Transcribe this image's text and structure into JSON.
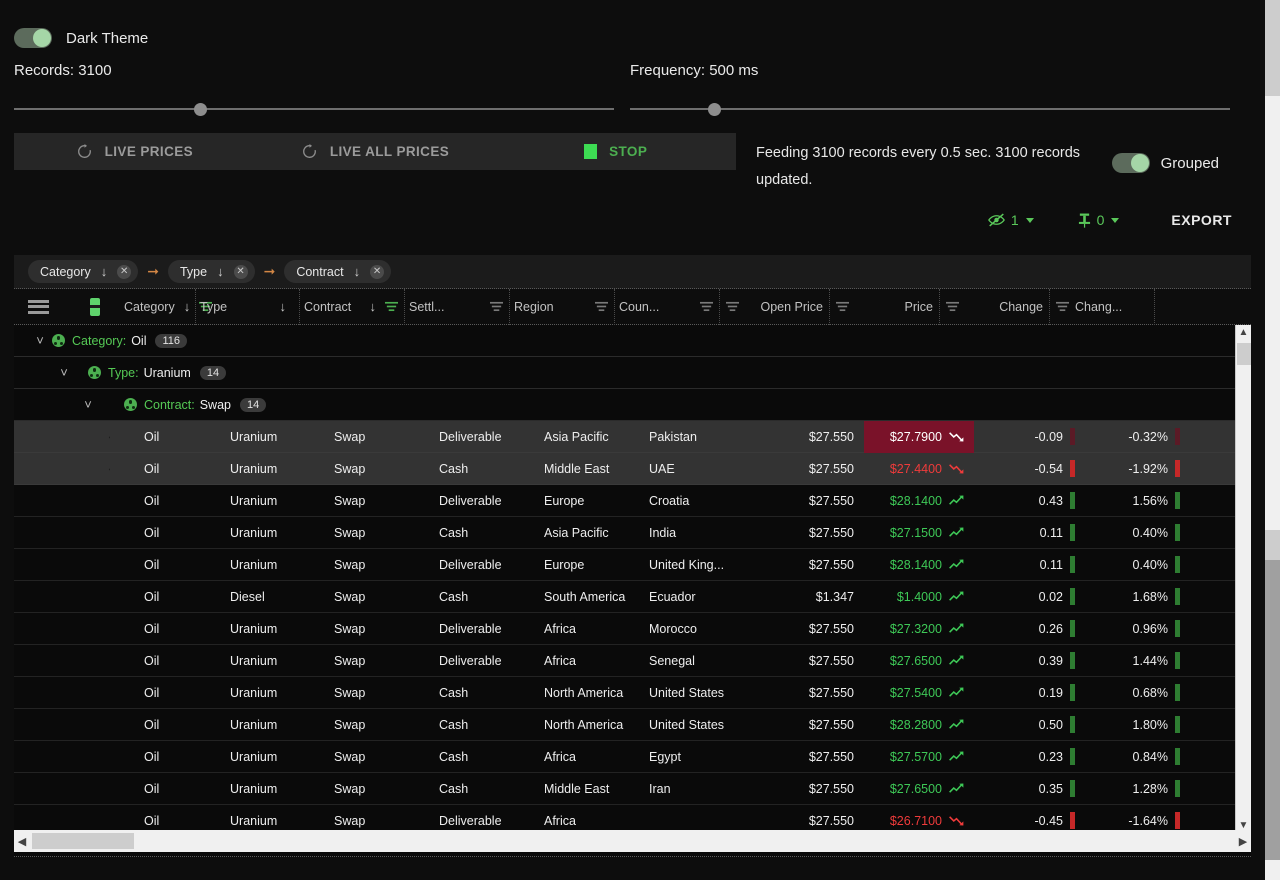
{
  "theme": {
    "toggle_on": true,
    "label": "Dark Theme"
  },
  "controls": {
    "records_label": "Records: 3100",
    "frequency_label": "Frequency: 500 ms"
  },
  "actions": {
    "live_prices": "LIVE PRICES",
    "live_all_prices": "LIVE ALL PRICES",
    "stop": "STOP"
  },
  "status": {
    "text": "Feeding 3100 records every 0.5 sec. 3100 records updated.",
    "grouped_label": "Grouped",
    "grouped_on": true
  },
  "grid_tools": {
    "hidden_count": "1",
    "pinned_count": "0",
    "export_label": "EXPORT"
  },
  "rowgroup_chips": [
    {
      "label": "Category"
    },
    {
      "label": "Type"
    },
    {
      "label": "Contract"
    }
  ],
  "columns": [
    {
      "key": "category",
      "label": "Category",
      "sort": "desc",
      "filter": true
    },
    {
      "key": "type",
      "label": "Type",
      "sort": "desc",
      "filter": false
    },
    {
      "key": "contract",
      "label": "Contract",
      "sort": "desc",
      "filter": true
    },
    {
      "key": "settl",
      "label": "Settl...",
      "filter": true
    },
    {
      "key": "region",
      "label": "Region",
      "filter": true
    },
    {
      "key": "country",
      "label": "Coun...",
      "filter": true
    },
    {
      "key": "open_price",
      "label": "Open Price",
      "filter": true
    },
    {
      "key": "price",
      "label": "Price",
      "filter": true
    },
    {
      "key": "change",
      "label": "Change",
      "filter": true
    },
    {
      "key": "change_pct",
      "label": "Chang...",
      "filter": true
    }
  ],
  "groups": [
    {
      "key": "Category",
      "value": "Oil",
      "count": "116",
      "level": 0
    },
    {
      "key": "Type",
      "value": "Uranium",
      "count": "14",
      "level": 1
    },
    {
      "key": "Contract",
      "value": "Swap",
      "count": "14",
      "level": 2
    }
  ],
  "rows": [
    {
      "selected": true,
      "category": "Oil",
      "type": "Uranium",
      "contract": "Swap",
      "settl": "Deliverable",
      "region": "Asia Pacific",
      "country": "Pakistan",
      "open_price": "$27.550",
      "price": "$27.7900",
      "dir": "down",
      "flash": true,
      "change": "-0.09",
      "change_pct": "-0.32%"
    },
    {
      "selected": true,
      "category": "Oil",
      "type": "Uranium",
      "contract": "Swap",
      "settl": "Cash",
      "region": "Middle East",
      "country": "UAE",
      "open_price": "$27.550",
      "price": "$27.4400",
      "dir": "down",
      "flash": false,
      "change": "-0.54",
      "change_pct": "-1.92%"
    },
    {
      "selected": false,
      "category": "Oil",
      "type": "Uranium",
      "contract": "Swap",
      "settl": "Deliverable",
      "region": "Europe",
      "country": "Croatia",
      "open_price": "$27.550",
      "price": "$28.1400",
      "dir": "up",
      "flash": false,
      "change": "0.43",
      "change_pct": "1.56%"
    },
    {
      "selected": false,
      "category": "Oil",
      "type": "Uranium",
      "contract": "Swap",
      "settl": "Cash",
      "region": "Asia Pacific",
      "country": "India",
      "open_price": "$27.550",
      "price": "$27.1500",
      "dir": "up",
      "flash": false,
      "change": "0.11",
      "change_pct": "0.40%"
    },
    {
      "selected": false,
      "category": "Oil",
      "type": "Uranium",
      "contract": "Swap",
      "settl": "Deliverable",
      "region": "Europe",
      "country": "United King...",
      "open_price": "$27.550",
      "price": "$28.1400",
      "dir": "up",
      "flash": false,
      "change": "0.11",
      "change_pct": "0.40%"
    },
    {
      "selected": false,
      "category": "Oil",
      "type": "Diesel",
      "contract": "Swap",
      "settl": "Cash",
      "region": "South America",
      "country": "Ecuador",
      "open_price": "$1.347",
      "price": "$1.4000",
      "dir": "up",
      "flash": false,
      "change": "0.02",
      "change_pct": "1.68%"
    },
    {
      "selected": false,
      "category": "Oil",
      "type": "Uranium",
      "contract": "Swap",
      "settl": "Deliverable",
      "region": "Africa",
      "country": "Morocco",
      "open_price": "$27.550",
      "price": "$27.3200",
      "dir": "up",
      "flash": false,
      "change": "0.26",
      "change_pct": "0.96%"
    },
    {
      "selected": false,
      "category": "Oil",
      "type": "Uranium",
      "contract": "Swap",
      "settl": "Deliverable",
      "region": "Africa",
      "country": "Senegal",
      "open_price": "$27.550",
      "price": "$27.6500",
      "dir": "up",
      "flash": false,
      "change": "0.39",
      "change_pct": "1.44%"
    },
    {
      "selected": false,
      "category": "Oil",
      "type": "Uranium",
      "contract": "Swap",
      "settl": "Cash",
      "region": "North America",
      "country": "United States",
      "open_price": "$27.550",
      "price": "$27.5400",
      "dir": "up",
      "flash": false,
      "change": "0.19",
      "change_pct": "0.68%"
    },
    {
      "selected": false,
      "category": "Oil",
      "type": "Uranium",
      "contract": "Swap",
      "settl": "Cash",
      "region": "North America",
      "country": "United States",
      "open_price": "$27.550",
      "price": "$28.2800",
      "dir": "up",
      "flash": false,
      "change": "0.50",
      "change_pct": "1.80%"
    },
    {
      "selected": false,
      "category": "Oil",
      "type": "Uranium",
      "contract": "Swap",
      "settl": "Cash",
      "region": "Africa",
      "country": "Egypt",
      "open_price": "$27.550",
      "price": "$27.5700",
      "dir": "up",
      "flash": false,
      "change": "0.23",
      "change_pct": "0.84%"
    },
    {
      "selected": false,
      "category": "Oil",
      "type": "Uranium",
      "contract": "Swap",
      "settl": "Cash",
      "region": "Middle East",
      "country": "Iran",
      "open_price": "$27.550",
      "price": "$27.6500",
      "dir": "up",
      "flash": false,
      "change": "0.35",
      "change_pct": "1.28%"
    },
    {
      "selected": false,
      "category": "Oil",
      "type": "Uranium",
      "contract": "Swap",
      "settl": "Deliverable",
      "region": "Africa",
      "country": "",
      "open_price": "$27.550",
      "price": "$26.7100",
      "dir": "down",
      "flash": false,
      "change": "-0.45",
      "change_pct": "-1.64%"
    }
  ],
  "colors": {
    "accent_green": "#4caf50",
    "up": "#3ec957",
    "down": "#ef3b3b",
    "flash_down_bg": "#7a1229",
    "chip_arrow": "#d38745"
  }
}
